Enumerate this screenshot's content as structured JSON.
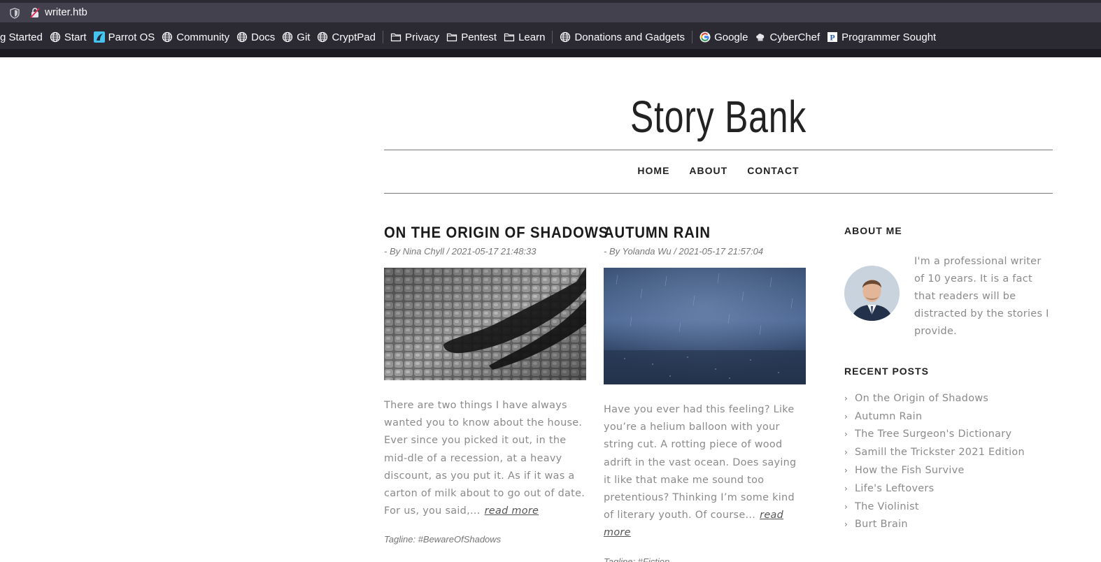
{
  "browser": {
    "url": "writer.htb",
    "bookmarks": [
      {
        "label": "g Started",
        "icon": "none"
      },
      {
        "label": "Start",
        "icon": "globe-icon"
      },
      {
        "label": "Parrot OS",
        "icon": "parrot-icon"
      },
      {
        "label": "Community",
        "icon": "globe-icon"
      },
      {
        "label": "Docs",
        "icon": "globe-icon"
      },
      {
        "label": "Git",
        "icon": "globe-icon"
      },
      {
        "label": "CryptPad",
        "icon": "globe-icon"
      },
      {
        "label": "Privacy",
        "icon": "folder-icon"
      },
      {
        "label": "Pentest",
        "icon": "folder-icon"
      },
      {
        "label": "Learn",
        "icon": "folder-icon"
      },
      {
        "label": "Donations and Gadgets",
        "icon": "globe-icon"
      },
      {
        "label": "Google",
        "icon": "google-icon"
      },
      {
        "label": "CyberChef",
        "icon": "chef-icon"
      },
      {
        "label": "Programmer Sought",
        "icon": "p-icon"
      }
    ]
  },
  "site": {
    "title": "Story Bank",
    "nav": [
      "HOME",
      "ABOUT",
      "CONTACT"
    ]
  },
  "posts": [
    {
      "title": "ON THE ORIGIN OF SHADOWS",
      "meta": "- By Nina Chyll / 2021-05-17 21:48:33",
      "body": "There are two things I have always wanted you to know about the house. Ever since you picked it out, in the mid-dle of a recession, at a heavy discount, as you put it. As if it was a carton of milk about to go out of date. For us, you said,...",
      "read_more": "read more",
      "tagline": "Tagline: #BewareOfShadows"
    },
    {
      "title": "AUTUMN RAIN",
      "meta": "- By Yolanda Wu / 2021-05-17 21:57:04",
      "body": "Have you ever had this feeling? Like you’re a helium balloon with your string cut. A rotting piece of wood adrift in the vast ocean. Does saying it like that make me sound too pretentious? Thinking I’m some kind of literary youth. Of course...",
      "read_more": "read more",
      "tagline": "Tagline: #Fiction"
    }
  ],
  "sidebar": {
    "about_heading": "ABOUT ME",
    "about_text": "I'm a professional writer of 10 years. It is a fact that readers will be distracted by the stories I provide.",
    "recent_heading": "RECENT POSTS",
    "recent_posts": [
      "On the Origin of Shadows",
      "Autumn Rain",
      "The Tree Surgeon's Dictionary",
      "Samill the Trickster 2021 Edition",
      "How the Fish Survive",
      "Life's Leftovers",
      "The Violinist",
      "Burt Brain"
    ]
  }
}
